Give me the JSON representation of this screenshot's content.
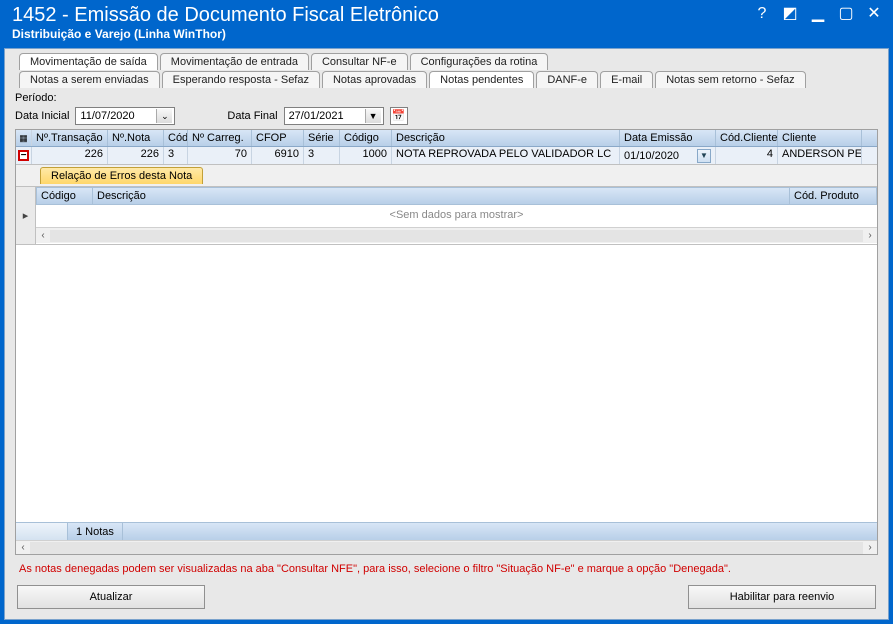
{
  "window": {
    "title": "1452 - Emissão de Documento Fiscal Eletrônico",
    "subtitle": "Distribuição e Varejo (Linha WinThor)"
  },
  "tabs_top": [
    "Movimentação de saída",
    "Movimentação de entrada",
    "Consultar NF-e",
    "Configurações da rotina"
  ],
  "tabs_sub": [
    "Notas a serem enviadas",
    "Esperando resposta - Sefaz",
    "Notas aprovadas",
    "Notas pendentes",
    "DANF-e",
    "E-mail",
    "Notas sem retorno - Sefaz"
  ],
  "active_top": 0,
  "active_sub": 3,
  "period": {
    "label": "Período:",
    "initial_label": "Data Inicial",
    "initial_value": "11/07/2020",
    "final_label": "Data Final",
    "final_value": "27/01/2021"
  },
  "grid": {
    "columns": [
      "Nº.Transação",
      "Nº.Nota",
      "Cód",
      "Nº Carreg.",
      "CFOP",
      "Série",
      "Código",
      "Descrição",
      "Data Emissão",
      "Cód.Cliente",
      "Cliente"
    ],
    "row": {
      "transacao": "226",
      "nota": "226",
      "cod": "3",
      "carreg": "70",
      "cfop": "6910",
      "serie": "3",
      "codigo": "1000",
      "descricao": "NOTA REPROVADA PELO VALIDADOR LC",
      "data_emissao": "01/10/2020",
      "cod_cliente": "4",
      "cliente": "ANDERSON PER"
    },
    "footer": "1 Notas"
  },
  "detail": {
    "tab": "Relação de Erros desta Nota",
    "columns": {
      "codigo": "Código",
      "descricao": "Descrição",
      "cod_produto": "Cód. Produto"
    },
    "empty": "<Sem dados para mostrar>"
  },
  "hint": "As notas denegadas podem ser visualizadas na aba \"Consultar NFE\", para isso, selecione o filtro \"Situação NF-e\" e marque a opção \"Denegada\".",
  "buttons": {
    "atualizar": "Atualizar",
    "habilitar": "Habilitar para reenvio"
  }
}
